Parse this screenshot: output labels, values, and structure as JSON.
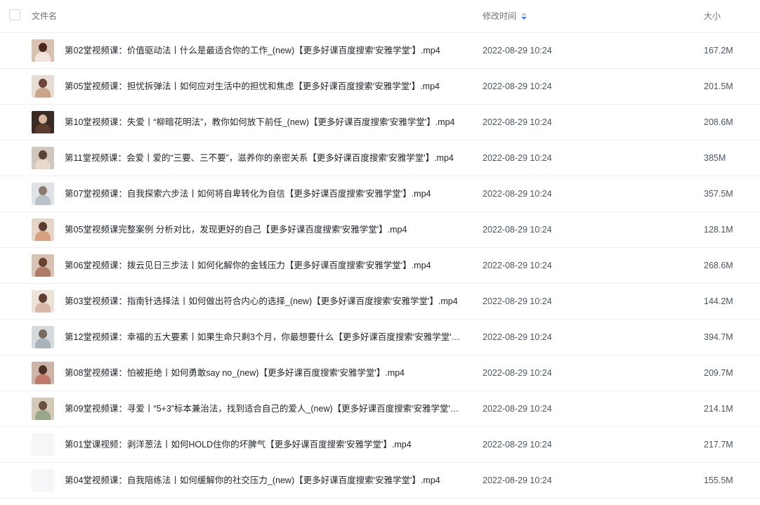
{
  "header": {
    "name": "文件名",
    "time": "修改时间",
    "size": "大小",
    "sort_icon": "sort-desc-icon"
  },
  "files": [
    {
      "name": "第02堂视频课：价值驱动法丨什么是最适合你的工作_(new)【更多好课百度搜索'安雅学堂'】.mp4",
      "time": "2022-08-29 10:24",
      "size": "167.2M",
      "thumb": {
        "bg": "#d9c3b0",
        "head": "#4a2a1e",
        "body": "#f2e6dc"
      }
    },
    {
      "name": "第05堂视频课：担忧拆弹法丨如何应对生活中的担忧和焦虑【更多好课百度搜索'安雅学堂'】.mp4",
      "time": "2022-08-29 10:24",
      "size": "201.5M",
      "thumb": {
        "bg": "#e8ddd2",
        "head": "#6b4535",
        "body": "#c9a48a"
      }
    },
    {
      "name": "第10堂视频课：失爱丨“柳暗花明法”，教你如何放下前任_(new)【更多好课百度搜索'安雅学堂'】.mp4",
      "time": "2022-08-29 10:24",
      "size": "208.6M",
      "thumb": {
        "bg": "#3a2a24",
        "head": "#d7b49a",
        "body": "#5a3c30"
      }
    },
    {
      "name": "第11堂视频课：会爱丨爱的“三要、三不要”，滋养你的亲密关系【更多好课百度搜索'安雅学堂'】.mp4",
      "time": "2022-08-29 10:24",
      "size": "385M",
      "thumb": {
        "bg": "#cfc6bd",
        "head": "#5b4034",
        "body": "#e7d9cc"
      }
    },
    {
      "name": "第07堂视频课：自我探索六步法丨如何将自卑转化为自信【更多好课百度搜索'安雅学堂'】.mp4",
      "time": "2022-08-29 10:24",
      "size": "357.5M",
      "thumb": {
        "bg": "#dfe3e6",
        "head": "#8a7b70",
        "body": "#b8c2c8"
      }
    },
    {
      "name": "第05堂视频课完整案例 分析对比，发现更好的自己【更多好课百度搜索'安雅学堂'】.mp4",
      "time": "2022-08-29 10:24",
      "size": "128.1M",
      "thumb": {
        "bg": "#e6d4c6",
        "head": "#5a3a2c",
        "body": "#d4a080"
      }
    },
    {
      "name": "第06堂视频课：拨云见日三步法丨如何化解你的金钱压力【更多好课百度搜索'安雅学堂'】.mp4",
      "time": "2022-08-29 10:24",
      "size": "268.6M",
      "thumb": {
        "bg": "#d8c2b4",
        "head": "#6a4030",
        "body": "#b07a68"
      }
    },
    {
      "name": "第03堂视频课：指南针选择法丨如何做出符合内心的选择_(new)【更多好课百度搜索'安雅学堂'】.mp4",
      "time": "2022-08-29 10:24",
      "size": "144.2M",
      "thumb": {
        "bg": "#ece2d8",
        "head": "#5e3e30",
        "body": "#d8b8a4"
      }
    },
    {
      "name": "第12堂视频课：幸福的五大要素丨如果生命只剩3个月，你最想要什么【更多好课百度搜索'安雅学堂'】.m...",
      "time": "2022-08-29 10:24",
      "size": "394.7M",
      "thumb": {
        "bg": "#d6dadc",
        "head": "#7a6a60",
        "body": "#a8b4ba"
      }
    },
    {
      "name": "第08堂视频课：怕被拒绝丨如何勇敢say no_(new)【更多好课百度搜索'安雅学堂'】.mp4",
      "time": "2022-08-29 10:24",
      "size": "209.7M",
      "thumb": {
        "bg": "#cdb4a8",
        "head": "#4e3228",
        "body": "#c07a6a"
      }
    },
    {
      "name": "第09堂视频课：寻爱丨“5+3”标本兼治法，找到适合自己的爱人_(new)【更多好课百度搜索'安雅学堂'】....",
      "time": "2022-08-29 10:24",
      "size": "214.1M",
      "thumb": {
        "bg": "#d4c8b8",
        "head": "#6a5040",
        "body": "#9aa68a"
      }
    },
    {
      "name": "第01堂课视频：剥洋葱法丨如何HOLD住你的坏脾气【更多好课百度搜索'安雅学堂'】.mp4",
      "time": "2022-08-29 10:24",
      "size": "217.7M",
      "thumb": {
        "bg": "#f5f6f8",
        "head": "",
        "body": "",
        "blank": true
      }
    },
    {
      "name": "第04堂视频课：自我陪练法丨如何缓解你的社交压力_(new)【更多好课百度搜索'安雅学堂'】.mp4",
      "time": "2022-08-29 10:24",
      "size": "155.5M",
      "thumb": {
        "bg": "#f5f6f8",
        "head": "",
        "body": "",
        "blank": true
      }
    }
  ]
}
